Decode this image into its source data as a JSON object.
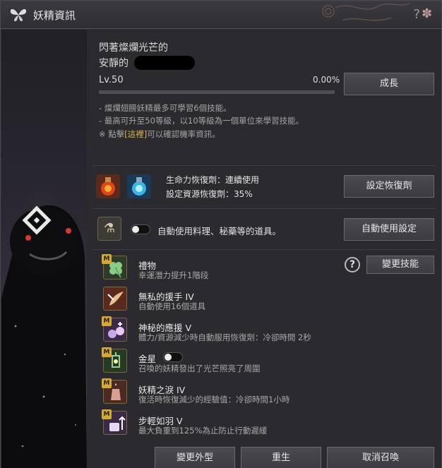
{
  "window": {
    "title": "妖精資訊"
  },
  "fairy": {
    "name_line1": "閃著燦爛光芒的",
    "name_line2": "安靜的",
    "level": "Lv.50",
    "progress_text": "0.00%",
    "progress": 0.0,
    "grow_button": "成長"
  },
  "notes": {
    "line1": "- 燦爛翅膀妖精最多可學習6個技能。",
    "line2": "- 最高可升至50等級，以10等級為一個單位來學習技能。",
    "line3_pre": "※ 點擊",
    "line3_link": "[這裡]",
    "line3_post": "可以確認機率資訊。"
  },
  "recovery": {
    "hp_text": "生命力恢復劑：連續使用",
    "resource_text": "設定資源恢復劑：35%",
    "button": "設定恢復劑"
  },
  "auto_use": {
    "text": "自動使用料理、秘藥等的道具。",
    "button": "自動使用設定"
  },
  "skills": {
    "change_button": "變更技能",
    "items": [
      {
        "badge": "M",
        "name": "禮物",
        "desc": "幸運潛力提升1階段"
      },
      {
        "badge": "",
        "name": "無私的援手 IV",
        "desc": "自動使用16個道具"
      },
      {
        "badge": "M",
        "name": "神秘的應援 V",
        "desc": "體力/資源減少時自動服用恢復劑：冷卻時間 2秒"
      },
      {
        "badge": "M",
        "name": "金星",
        "desc": "召喚的妖精發出了光芒照亮了周圍"
      },
      {
        "badge": "M",
        "name": "妖精之淚 IV",
        "desc": "復活時恢復減少的經驗值：冷卻時間1小時"
      },
      {
        "badge": "M",
        "name": "步輕如羽 V",
        "desc": "最大負重到125%為止防止行動遲緩"
      }
    ]
  },
  "footer": {
    "change_appearance": "變更外型",
    "rebirth": "重生",
    "cancel_summon": "取消召喚"
  },
  "icons": {
    "title": "butterfly-icon",
    "close": "close-icon",
    "help": "help-icon"
  }
}
